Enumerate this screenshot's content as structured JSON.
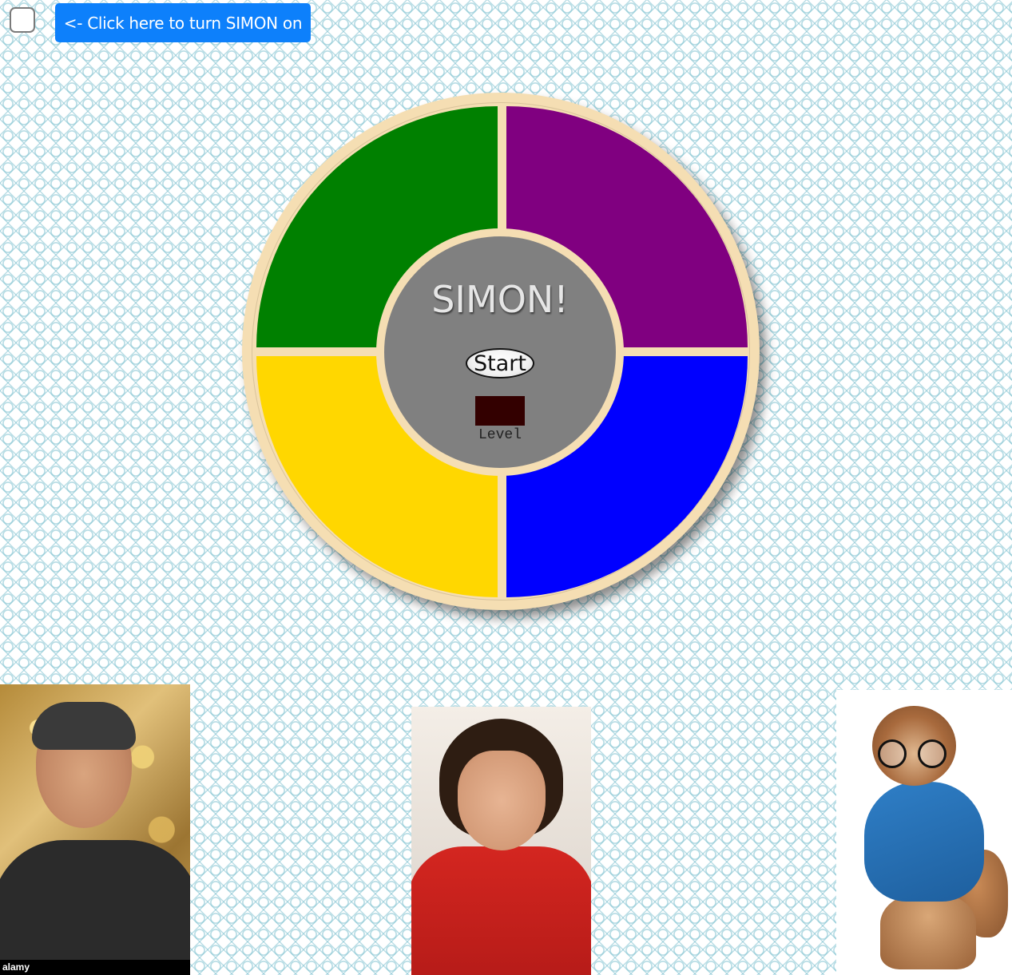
{
  "controls": {
    "power_checked": false,
    "power_button_label": "<- Click here to turn SIMON on"
  },
  "game": {
    "title": "SIMON!",
    "start_label": "Start",
    "level_label": "Level",
    "level_value": "",
    "pads": [
      {
        "name": "green",
        "color": "#008000"
      },
      {
        "name": "purple",
        "color": "#800080"
      },
      {
        "name": "yellow",
        "color": "#ffd700"
      },
      {
        "name": "blue",
        "color": "#0000ff"
      }
    ],
    "board_color": "#f5deb3",
    "center_color": "#808080",
    "level_display_color": "#330000"
  },
  "photos": {
    "left_watermark": "alamy"
  },
  "colors": {
    "button_blue": "#0d80fb"
  }
}
